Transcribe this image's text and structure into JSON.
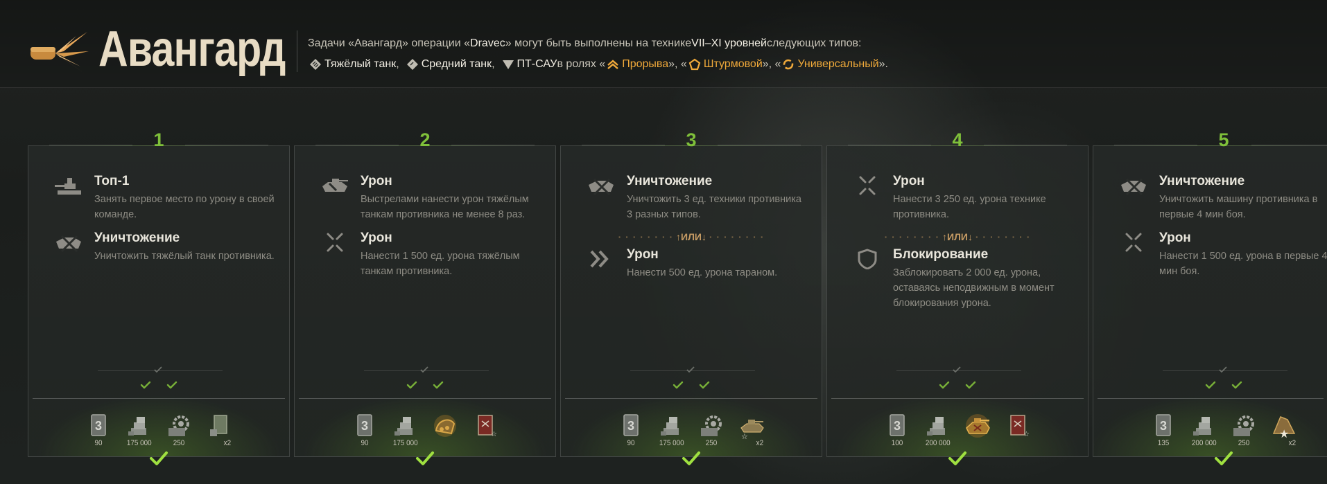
{
  "header": {
    "title": "Авангард",
    "line1": {
      "p1": "Задачи «Авангард» операции «",
      "op": "Dravec",
      "p2": "» могут быть выполнены на технике ",
      "levels": "VII–XI уровней",
      "p3": " следующих типов:"
    },
    "line2": {
      "heavy": "Тяжёлый танк",
      "c1": ",",
      "medium": "Средний танк",
      "c2": ",",
      "td": "ПТ-САУ",
      "roles_prefix": " в ролях «",
      "role1": "Прорыва",
      "sep1": "», «",
      "role2": "Штурмовой",
      "sep2": "», «",
      "role3": "Универсальный",
      "end": "»."
    }
  },
  "colors": {
    "accent_green": "#7fc03a",
    "orange": "#f0a93a"
  },
  "or_label": "ИЛИ",
  "cards": [
    {
      "number": "1",
      "tasks": [
        {
          "icon": "top1-icon",
          "title": "Топ-1",
          "desc": "Занять первое место по урону в своей команде."
        },
        {
          "icon": "destroy-icon",
          "title": "Уничтожение",
          "desc": "Уничтожить тяжёлый танк противника."
        }
      ],
      "rewards": [
        {
          "icon": "directive-card-icon",
          "value": "90"
        },
        {
          "icon": "credits-icon",
          "value": "175 000"
        },
        {
          "icon": "gear-item-icon",
          "value": "250"
        },
        {
          "icon": "booster-card-icon",
          "value": "x2"
        }
      ]
    },
    {
      "number": "2",
      "tasks": [
        {
          "icon": "damage-tank-icon",
          "title": "Урон",
          "desc": "Выстрелами нанести урон тяжёлым танкам противника не менее 8 раз."
        },
        {
          "icon": "damage-cross-icon",
          "title": "Урон",
          "desc": "Нанести 1 500 ед. урона тяжёлым танкам противника."
        }
      ],
      "rewards": [
        {
          "icon": "directive-card-icon",
          "value": "90"
        },
        {
          "icon": "credits-icon",
          "value": "175 000"
        },
        {
          "icon": "gold-track-icon",
          "value": ""
        },
        {
          "icon": "red-document-icon",
          "value": ""
        }
      ]
    },
    {
      "number": "3",
      "tasks": [
        {
          "icon": "destroy-icon",
          "title": "Уничтожение",
          "desc": "Уничтожить 3 ед. техники противника 3 разных типов."
        },
        {
          "icon": "ram-chevron-icon",
          "title": "Урон",
          "desc": "Нанести 500 ед. урона тараном."
        }
      ],
      "rewards": [
        {
          "icon": "directive-card-icon",
          "value": "90"
        },
        {
          "icon": "credits-icon",
          "value": "175 000"
        },
        {
          "icon": "gear-item-icon",
          "value": "250"
        },
        {
          "icon": "tank-star-icon",
          "value": "x2"
        }
      ]
    },
    {
      "number": "4",
      "tasks": [
        {
          "icon": "damage-cross-icon",
          "title": "Урон",
          "desc": "Нанести 3 250 ед. урона технике противника."
        },
        {
          "icon": "shield-icon",
          "title": "Блокирование",
          "desc": "Заблокировать 2 000 ед. урона, оставаясь неподвижным в момент блокирования урона."
        }
      ],
      "rewards": [
        {
          "icon": "directive-card-icon",
          "value": "100"
        },
        {
          "icon": "credits-icon",
          "value": "200 000"
        },
        {
          "icon": "gold-tank-icon",
          "value": ""
        },
        {
          "icon": "red-document-icon",
          "value": ""
        }
      ]
    },
    {
      "number": "5",
      "tasks": [
        {
          "icon": "destroy-icon",
          "title": "Уничтожение",
          "desc": "Уничтожить машину противника в первые 4 мин боя."
        },
        {
          "icon": "damage-cross-icon",
          "title": "Урон",
          "desc": "Нанести 1 500 ед. урона в первые 4 мин боя."
        }
      ],
      "rewards": [
        {
          "icon": "directive-card-icon",
          "value": "135"
        },
        {
          "icon": "credits-icon",
          "value": "200 000"
        },
        {
          "icon": "gear-item-icon",
          "value": "250"
        },
        {
          "icon": "star-badge-icon",
          "value": "x2"
        }
      ]
    }
  ]
}
